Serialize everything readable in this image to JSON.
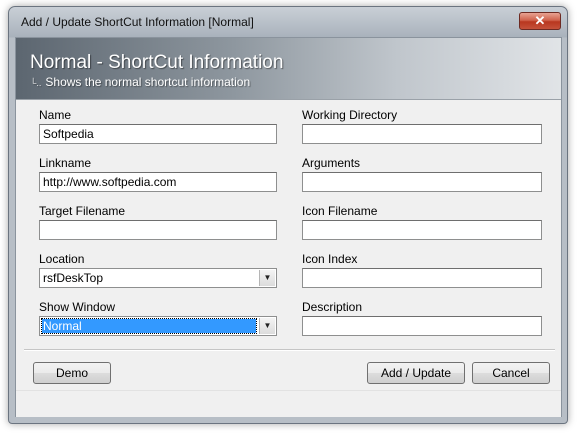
{
  "window": {
    "title": "Add / Update ShortCut Information [Normal]",
    "close_glyph": "✕"
  },
  "header": {
    "title": "Normal - ShortCut Information",
    "subtitle_glyph": "└..",
    "subtitle": "Shows the normal shortcut information"
  },
  "left": {
    "name_label": "Name",
    "name_value": "Softpedia",
    "linkname_label": "Linkname",
    "linkname_value": "http://www.softpedia.com",
    "target_label": "Target Filename",
    "target_value": "",
    "location_label": "Location",
    "location_value": "rsfDeskTop",
    "show_window_label": "Show Window",
    "show_window_value": "Normal"
  },
  "right": {
    "working_dir_label": "Working Directory",
    "working_dir_value": "",
    "arguments_label": "Arguments",
    "arguments_value": "",
    "icon_filename_label": "Icon Filename",
    "icon_filename_value": "",
    "icon_index_label": "Icon Index",
    "icon_index_value": "",
    "description_label": "Description",
    "description_value": ""
  },
  "buttons": {
    "demo": "Demo",
    "add_update": "Add / Update",
    "cancel": "Cancel"
  },
  "icons": {
    "combo_arrow": "▼"
  }
}
